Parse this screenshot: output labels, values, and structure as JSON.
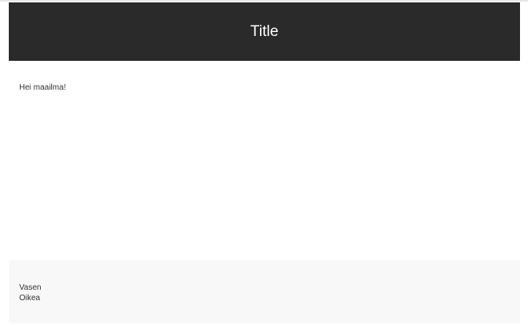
{
  "header": {
    "title": "Title"
  },
  "main": {
    "text": "Hei maailma!"
  },
  "footer": {
    "left": "Vasen",
    "right": "Oikea"
  }
}
